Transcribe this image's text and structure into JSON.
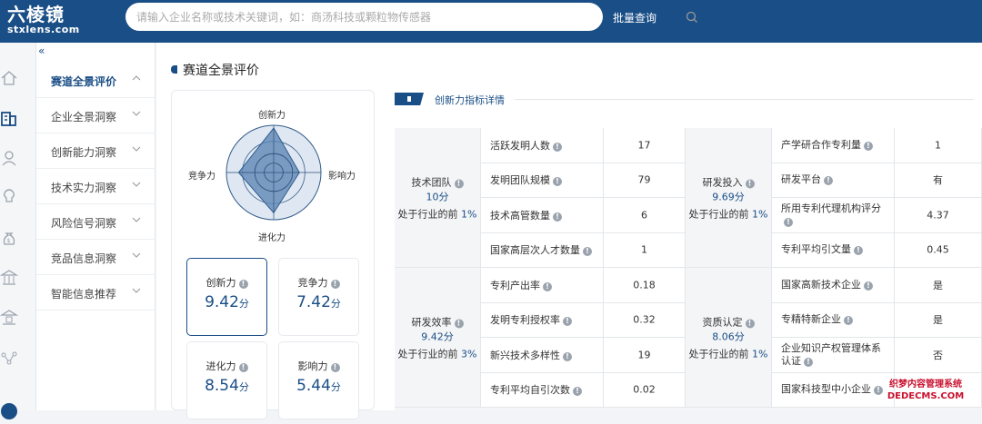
{
  "header": {
    "logo_cn": "六棱镜",
    "logo_en": "stxlens.com",
    "search_placeholder": "请输入企业名称或技术关键词，如：商汤科技或颗粒物传感器",
    "batch_label": "批量查询"
  },
  "sidenav": {
    "collapse": "«",
    "items": [
      {
        "label": "赛道全景评价",
        "active": true
      },
      {
        "label": "企业全景洞察"
      },
      {
        "label": "创新能力洞察"
      },
      {
        "label": "技术实力洞察"
      },
      {
        "label": "风险信号洞察"
      },
      {
        "label": "竞品信息洞察"
      },
      {
        "label": "智能信息推荐"
      }
    ]
  },
  "main": {
    "title": "赛道全景评价",
    "radar": {
      "axes": [
        "创新力",
        "影响力",
        "进化力",
        "竞争力"
      ],
      "values": [
        9.42,
        5.44,
        8.54,
        7.42
      ],
      "max": 10
    },
    "scores": [
      {
        "name": "创新力",
        "value": "9.42",
        "unit": "分"
      },
      {
        "name": "竞争力",
        "value": "7.42",
        "unit": "分"
      },
      {
        "name": "进化力",
        "value": "8.54",
        "unit": "分"
      },
      {
        "name": "影响力",
        "value": "5.44",
        "unit": "分"
      }
    ],
    "tab_title": "创新力指标详情",
    "groups": [
      {
        "name": "技术团队",
        "score": "10分",
        "rank_prefix": "处于行业的前",
        "rank": "1%"
      },
      {
        "name": "研发投入",
        "score": "9.69分",
        "rank_prefix": "处于行业的前",
        "rank": "1%"
      },
      {
        "name": "研发效率",
        "score": "9.42分",
        "rank_prefix": "处于行业的前",
        "rank": "3%"
      },
      {
        "name": "资质认定",
        "score": "8.06分",
        "rank_prefix": "处于行业的前",
        "rank": "1%"
      }
    ],
    "rows_left": [
      {
        "label": "活跃发明人数",
        "value": "17"
      },
      {
        "label": "发明团队规模",
        "value": "79"
      },
      {
        "label": "技术高管数量",
        "value": "6"
      },
      {
        "label": "国家高层次人才数量",
        "value": "1"
      },
      {
        "label": "专利产出率",
        "value": "0.18"
      },
      {
        "label": "发明专利授权率",
        "value": "0.32"
      },
      {
        "label": "新兴技术多样性",
        "value": "19"
      },
      {
        "label": "专利平均自引次数",
        "value": "0.02"
      }
    ],
    "rows_right": [
      {
        "label": "产学研合作专利量",
        "value": "1"
      },
      {
        "label": "研发平台",
        "value": "有"
      },
      {
        "label": "所用专利代理机构评分",
        "value": "4.37"
      },
      {
        "label": "专利平均引文量",
        "value": "0.45"
      },
      {
        "label": "国家高新技术企业",
        "value": "是"
      },
      {
        "label": "专精特新企业",
        "value": "是"
      },
      {
        "label": "企业知识产权管理体系认证",
        "value": "否"
      },
      {
        "label": "国家科技型中小企业",
        "value": ""
      }
    ]
  },
  "watermark": {
    "line1": "织梦内容管理系统",
    "line2": "DEDECMS.COM"
  },
  "colors": {
    "brand": "#1a4e86"
  }
}
